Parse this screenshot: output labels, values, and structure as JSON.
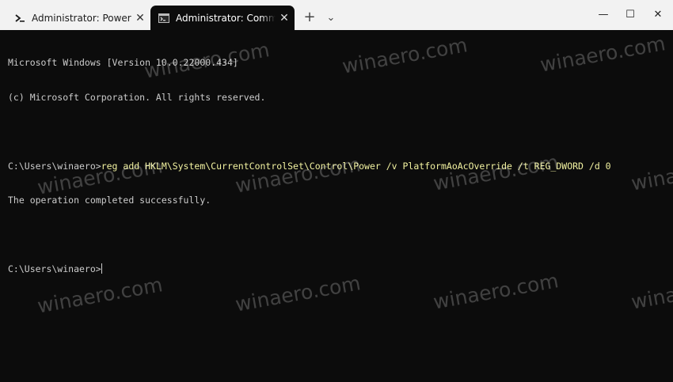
{
  "tabs": [
    {
      "title": "Administrator: PowerShell",
      "icon": "powershell-icon",
      "active": false
    },
    {
      "title": "Administrator: Command Prompt",
      "icon": "command-prompt-icon",
      "active": true
    }
  ],
  "tabbar": {
    "close_glyph": "✕",
    "new_tab_glyph": "+",
    "dropdown_glyph": "⌄"
  },
  "window_controls": {
    "minimize": "—",
    "maximize": "☐",
    "close": "✕"
  },
  "console": {
    "line1": "Microsoft Windows [Version 10.0.22000.434]",
    "line2": "(c) Microsoft Corporation. All rights reserved.",
    "prompt1": "C:\\Users\\winaero>",
    "command": "reg add HKLM\\System\\CurrentControlSet\\Control\\Power /v PlatformAoAcOverride /t REG_DWORD /d 0",
    "output": "The operation completed successfully.",
    "prompt2": "C:\\Users\\winaero>"
  },
  "watermark": {
    "text": "winaero.com"
  },
  "colors": {
    "console_bg": "#0c0c0c",
    "console_text": "#cccccc",
    "command_text": "#f2f2a0",
    "titlebar_bg": "#f2f2f2"
  }
}
